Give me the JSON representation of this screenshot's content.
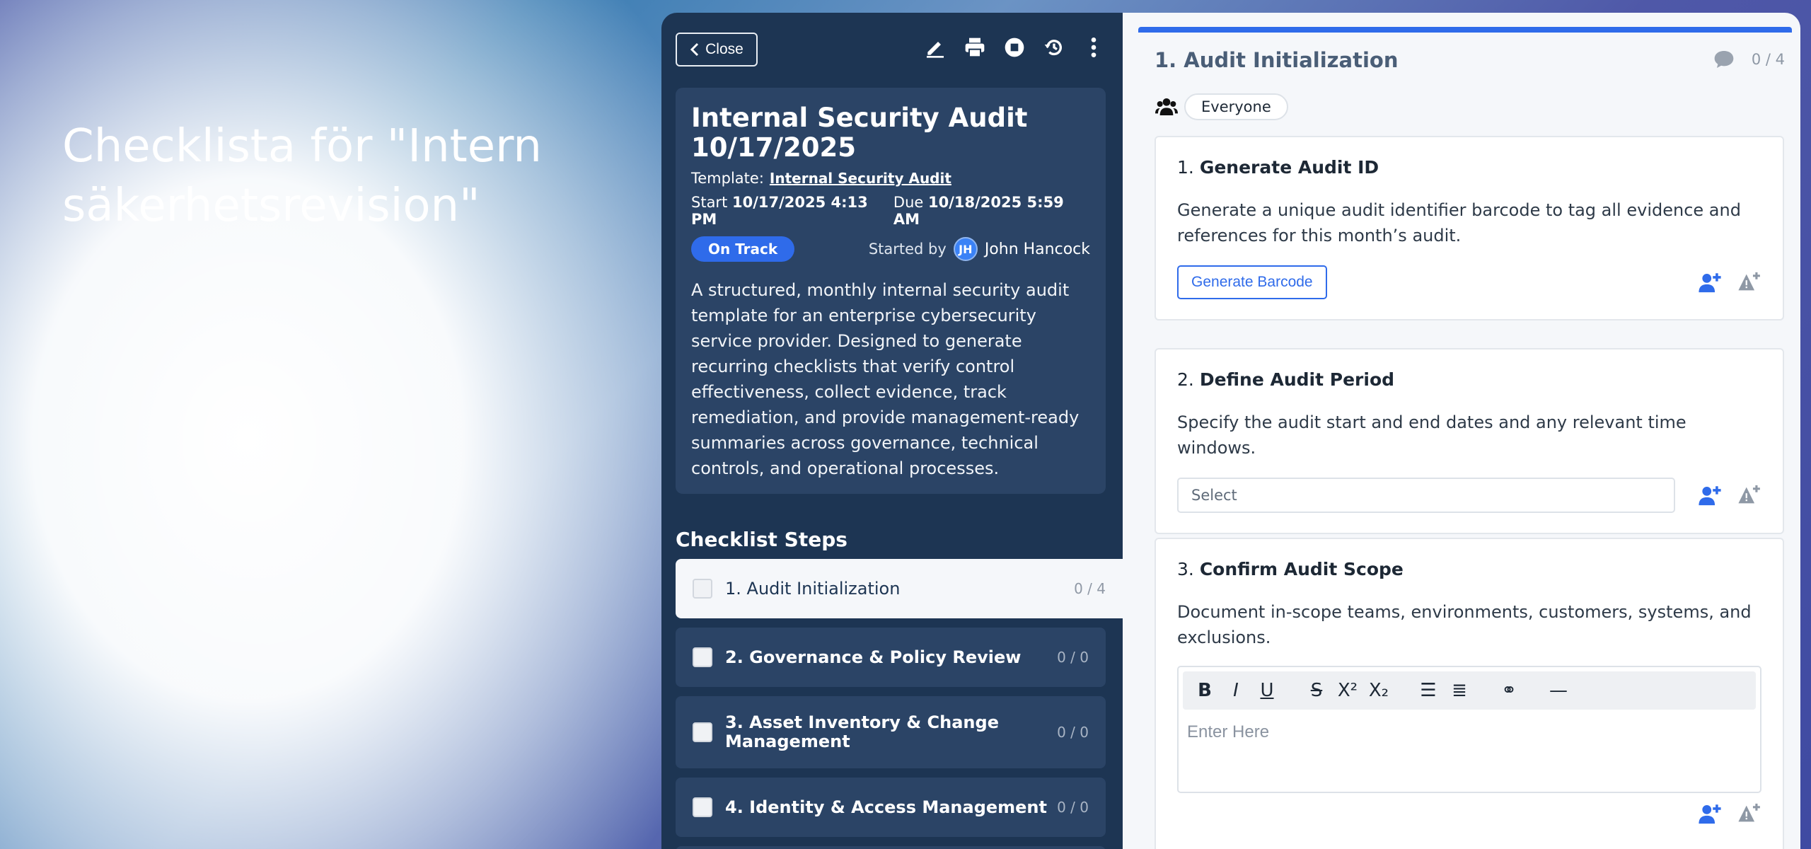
{
  "hero": {
    "title": "Checklista för \"Intern säkerhetsrevision\""
  },
  "toolbar": {
    "close_label": "Close",
    "icons": [
      "pencil-icon",
      "print-icon",
      "stop-icon",
      "history-icon",
      "more-vertical-icon"
    ]
  },
  "audit": {
    "title": "Internal Security Audit 10/17/2025",
    "template_label": "Template:",
    "template_name": "Internal Security Audit",
    "start_label": "Start",
    "start_value": "10/17/2025 4:13 PM",
    "due_label": "Due",
    "due_value": "10/18/2025 5:59 AM",
    "status": "On Track",
    "started_by_label": "Started by",
    "user_initials": "JH",
    "user_name": "John Hancock",
    "description": "A structured, monthly internal security audit template for an enterprise cybersecurity service provider. Designed to generate recurring checklists that verify control effectiveness, collect evidence, track remediation, and provide management-ready summaries across governance, technical controls, and operational processes."
  },
  "steps": {
    "heading": "Checklist Steps",
    "items": [
      {
        "label": "1. Audit Initialization",
        "count": "0 / 4"
      },
      {
        "label": "2. Governance & Policy Review",
        "count": "0 / 0"
      },
      {
        "label": "3. Asset Inventory & Change Management",
        "count": "0 / 0"
      },
      {
        "label": "4. Identity & Access Management",
        "count": "0 / 0"
      }
    ]
  },
  "section": {
    "title": "1. Audit Initialization",
    "count": "0 / 4",
    "assignee": "Everyone"
  },
  "tasks": [
    {
      "number": "1.",
      "title": "Generate Audit ID",
      "description": "Generate a unique audit identifier barcode to tag all evidence and references for this month’s audit.",
      "button_label": "Generate Barcode"
    },
    {
      "number": "2.",
      "title": "Define Audit Period",
      "description": "Specify the audit start and end dates and any relevant time windows.",
      "select_placeholder": "Select"
    },
    {
      "number": "3.",
      "title": "Confirm Audit Scope",
      "description": "Document in-scope teams, environments, customers, systems, and exclusions.",
      "editor_placeholder": "Enter Here"
    }
  ],
  "colors": {
    "accent": "#2f6bea",
    "sidebar": "#1d3553",
    "card": "#2b4466"
  }
}
